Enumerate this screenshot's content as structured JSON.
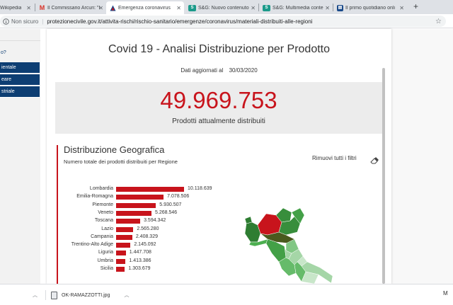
{
  "browser": {
    "tabs": [
      {
        "title": "Wikipedia",
        "favicon": "W"
      },
      {
        "title": "Il Commissario Arcuri: \"I",
        "favicon": "M"
      },
      {
        "title": "Emergenza coronavirus",
        "favicon": "warning-triangle"
      },
      {
        "title": "S&G: Nuovo contenuto",
        "favicon": "S&G"
      },
      {
        "title": "S&G: Multimedia conte",
        "favicon": "S&G"
      },
      {
        "title": "Il primo quotidiano onli",
        "favicon": "news"
      }
    ],
    "new_tab": "+",
    "security": "Non sicuro",
    "url": "protezionecivile.gov.it/attivita-rischi/rischio-sanitario/emergenze/coronavirus/materiali-distribuiti-alle-regioni"
  },
  "sidebar": {
    "items": [
      {
        "label": "o?",
        "highlight": false
      },
      {
        "label": "ientale",
        "highlight": true
      },
      {
        "label": "eare",
        "highlight": true
      },
      {
        "label": "striale",
        "highlight": true
      }
    ]
  },
  "dashboard": {
    "title": "Covid 19 - Analisi Distribuzione per Prodotto",
    "updated_label": "Dati aggiornati al",
    "updated_date": "30/03/2020",
    "total": "49.969.753",
    "total_label": "Prodotti attualmente distribuiti",
    "section_title": "Distribuzione Geografica",
    "section_subtitle": "Numero totale dei prodotti distribuiti per Regione",
    "reset_filters": "Rimuovi tutti i filtri",
    "accent_color": "#c8141c"
  },
  "chart_data": {
    "type": "bar",
    "orientation": "horizontal",
    "categories": [
      "Lombardia",
      "Emilia-Romagna",
      "Piemonte",
      "Veneto",
      "Toscana",
      "Lazio",
      "Campania",
      "Trentino-Alto Adige",
      "Liguria",
      "Umbria",
      "Sicilia"
    ],
    "values": [
      10118639,
      7078506,
      5930507,
      5268546,
      3594342,
      2565280,
      2408329,
      2145092,
      1447708,
      1413386,
      1303679
    ],
    "labels": [
      "10.118.639",
      "7.078.506",
      "5.930.507",
      "5.268.546",
      "3.594.342",
      "2.565.280",
      "2.408.329",
      "2.145.092",
      "1.447.708",
      "1.413.386",
      "1.303.679"
    ],
    "color": "#c8141c"
  },
  "downloads": [
    {
      "name": ""
    },
    {
      "name": "OK-RAMAZZOTTI.jpg"
    }
  ]
}
